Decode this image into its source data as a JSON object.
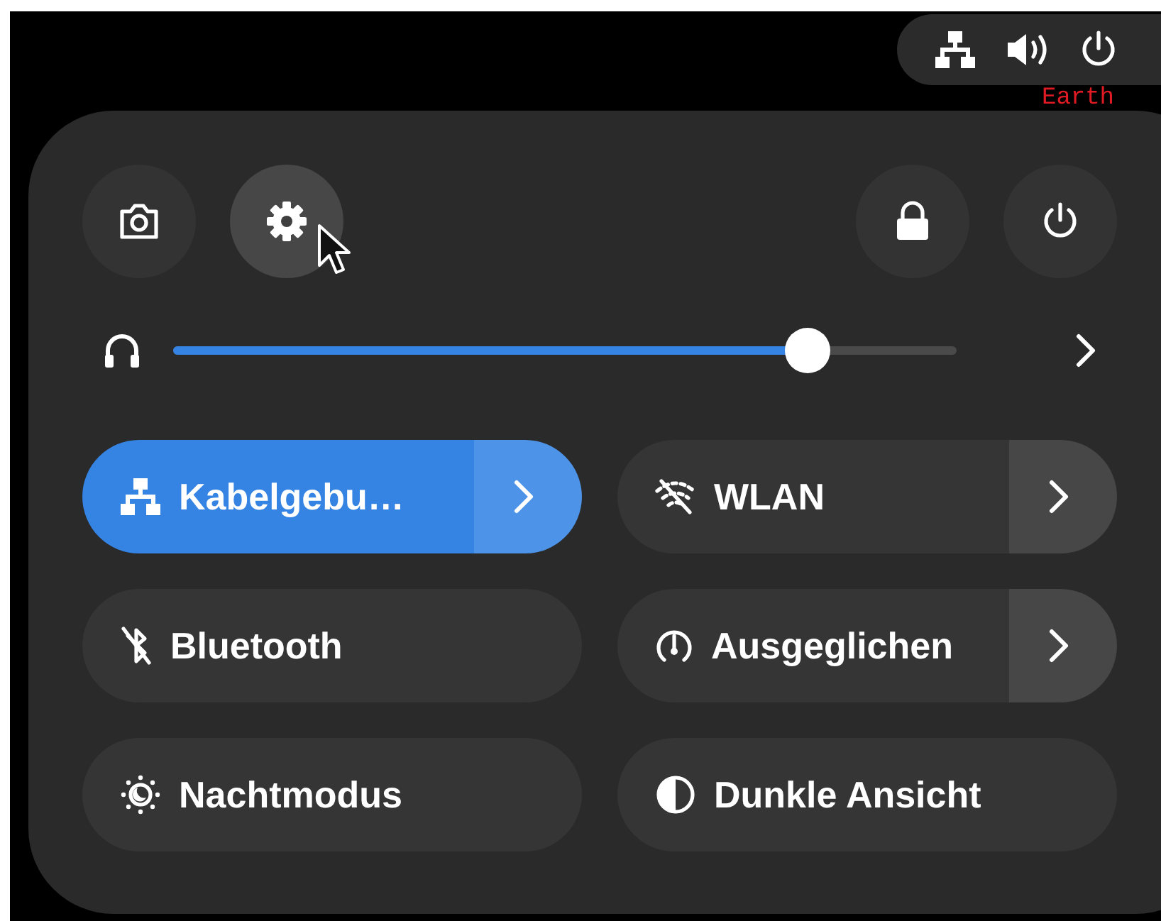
{
  "top_bar": {
    "indicators": [
      {
        "kind": "network"
      },
      {
        "kind": "volume"
      },
      {
        "kind": "power"
      }
    ]
  },
  "background_text": "Earth",
  "quick_settings": {
    "buttons": [
      {
        "kind": "screenshot",
        "hovered": false
      },
      {
        "kind": "settings",
        "hovered": true
      },
      {
        "kind": "lock",
        "hovered": false
      },
      {
        "kind": "power",
        "hovered": false
      }
    ],
    "volume": {
      "level": 0.81
    },
    "toggles": [
      {
        "kind": "wired",
        "label": "Kabelgebu…",
        "active": true,
        "has_menu": true
      },
      {
        "kind": "wifi",
        "label": "WLAN",
        "active": false,
        "has_menu": true
      },
      {
        "kind": "bluetooth",
        "label": "Bluetooth",
        "active": false,
        "has_menu": false
      },
      {
        "kind": "power-profile",
        "label": "Ausgeglichen",
        "active": false,
        "has_menu": true
      },
      {
        "kind": "night",
        "label": "Nachtmodus",
        "active": false,
        "has_menu": false
      },
      {
        "kind": "dark",
        "label": "Dunkle Ansicht",
        "active": false,
        "has_menu": false
      }
    ]
  }
}
